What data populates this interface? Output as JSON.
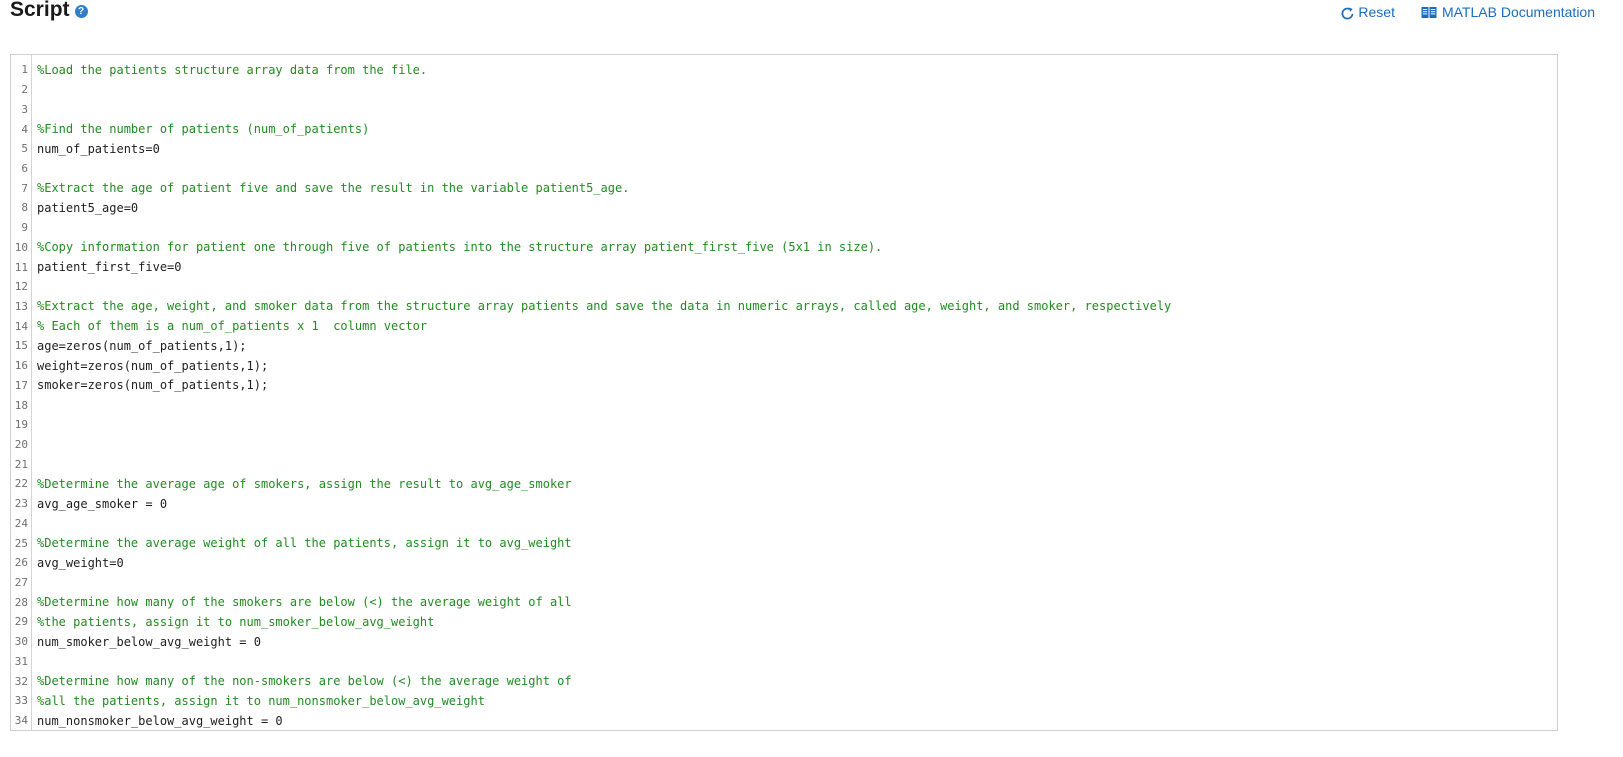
{
  "header": {
    "title": "Script",
    "help_icon": "question-circle-icon",
    "reset_label": "Reset",
    "docs_label": "MATLAB Documentation"
  },
  "colors": {
    "comment": "#228b22",
    "link": "#1a6dbe",
    "help_icon": "#2f7ec8"
  },
  "editor": {
    "lines": [
      {
        "n": "1",
        "text": "%Load the patients structure array data from the file.",
        "comment": true
      },
      {
        "n": "2",
        "text": "",
        "comment": false
      },
      {
        "n": "3",
        "text": "",
        "comment": false
      },
      {
        "n": "4",
        "text": "%Find the number of patients (num_of_patients)",
        "comment": true
      },
      {
        "n": "5",
        "text": "num_of_patients=0",
        "comment": false
      },
      {
        "n": "6",
        "text": "",
        "comment": false
      },
      {
        "n": "7",
        "text": "%Extract the age of patient five and save the result in the variable patient5_age.",
        "comment": true
      },
      {
        "n": "8",
        "text": "patient5_age=0",
        "comment": false
      },
      {
        "n": "9",
        "text": "",
        "comment": false
      },
      {
        "n": "10",
        "text": "%Copy information for patient one through five of patients into the structure array patient_first_five (5x1 in size).",
        "comment": true
      },
      {
        "n": "11",
        "text": "patient_first_five=0",
        "comment": false
      },
      {
        "n": "12",
        "text": "",
        "comment": false
      },
      {
        "n": "13",
        "text": "%Extract the age, weight, and smoker data from the structure array patients and save the data in numeric arrays, called age, weight, and smoker, respectively",
        "comment": true
      },
      {
        "n": "14",
        "text": "% Each of them is a num_of_patients x 1  column vector",
        "comment": true
      },
      {
        "n": "15",
        "text": "age=zeros(num_of_patients,1);",
        "comment": false
      },
      {
        "n": "16",
        "text": "weight=zeros(num_of_patients,1);",
        "comment": false
      },
      {
        "n": "17",
        "text": "smoker=zeros(num_of_patients,1);",
        "comment": false
      },
      {
        "n": "18",
        "text": "",
        "comment": false
      },
      {
        "n": "19",
        "text": "",
        "comment": false
      },
      {
        "n": "20",
        "text": "",
        "comment": false
      },
      {
        "n": "21",
        "text": "",
        "comment": false
      },
      {
        "n": "22",
        "text": "%Determine the average age of smokers, assign the result to avg_age_smoker",
        "comment": true
      },
      {
        "n": "23",
        "text": "avg_age_smoker = 0",
        "comment": false
      },
      {
        "n": "24",
        "text": "",
        "comment": false
      },
      {
        "n": "25",
        "text": "%Determine the average weight of all the patients, assign it to avg_weight",
        "comment": true
      },
      {
        "n": "26",
        "text": "avg_weight=0",
        "comment": false
      },
      {
        "n": "27",
        "text": "",
        "comment": false
      },
      {
        "n": "28",
        "text": "%Determine how many of the smokers are below (<) the average weight of all",
        "comment": true
      },
      {
        "n": "29",
        "text": "%the patients, assign it to num_smoker_below_avg_weight",
        "comment": true
      },
      {
        "n": "30",
        "text": "num_smoker_below_avg_weight = 0",
        "comment": false
      },
      {
        "n": "31",
        "text": "",
        "comment": false
      },
      {
        "n": "32",
        "text": "%Determine how many of the non-smokers are below (<) the average weight of",
        "comment": true
      },
      {
        "n": "33",
        "text": "%all the patients, assign it to num_nonsmoker_below_avg_weight",
        "comment": true
      },
      {
        "n": "34",
        "text": "num_nonsmoker_below_avg_weight = 0",
        "comment": false
      }
    ]
  }
}
